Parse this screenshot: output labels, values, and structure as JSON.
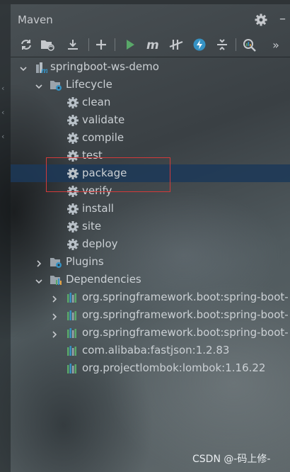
{
  "panel": {
    "title": "Maven"
  },
  "toolbar": {
    "buttons": [
      {
        "name": "reload-all-icon"
      },
      {
        "name": "generate-sources-icon"
      },
      {
        "name": "download-sources-icon"
      },
      {
        "name": "add-project-icon"
      },
      {
        "name": "run-icon"
      },
      {
        "name": "execute-goal-icon"
      },
      {
        "name": "toggle-offline-icon"
      },
      {
        "name": "skip-tests-icon"
      },
      {
        "name": "collapse-all-icon"
      },
      {
        "name": "analyze-dependencies-icon"
      },
      {
        "name": "more-icon"
      }
    ]
  },
  "tree": {
    "project": "springboot-ws-demo",
    "lifecycle": {
      "label": "Lifecycle",
      "goals": [
        "clean",
        "validate",
        "compile",
        "test",
        "package",
        "verify",
        "install",
        "site",
        "deploy"
      ],
      "selected": "package"
    },
    "plugins": {
      "label": "Plugins"
    },
    "dependencies": {
      "label": "Dependencies",
      "items": [
        "org.springframework.boot:spring-boot-",
        "org.springframework.boot:spring-boot-",
        "org.springframework.boot:spring-boot-",
        "com.alibaba:fastjson:1.2.83",
        "org.projectlombok:lombok:1.16.22"
      ]
    }
  },
  "watermark": "CSDN @-码上修-",
  "colors": {
    "selection": "#1c3858",
    "highlight_border": "#d33a3a",
    "run_green": "#59a869",
    "offline_blue": "#3592c4"
  }
}
